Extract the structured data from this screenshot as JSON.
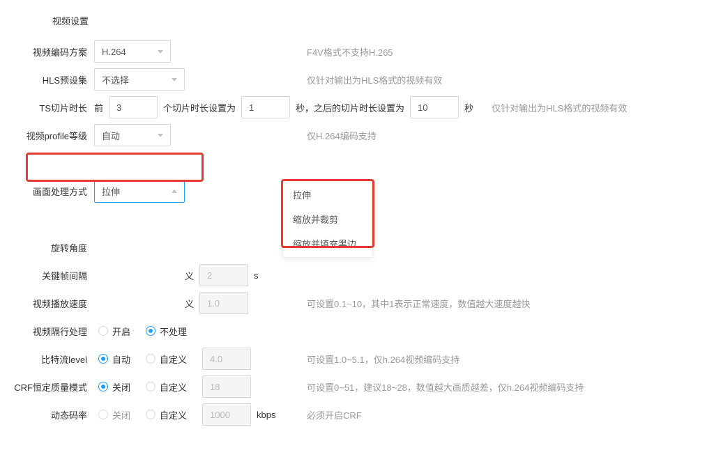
{
  "section_title": "视频设置",
  "rows": {
    "codec": {
      "label": "视频编码方案",
      "value": "H.264",
      "hint": "F4V格式不支持H.265"
    },
    "hls": {
      "label": "HLS预设集",
      "value": "不选择",
      "hint": "仅针对输出为HLS格式的视频有效"
    },
    "ts": {
      "label": "TS切片时长",
      "t1": "前",
      "v1": "3",
      "t2": "个切片时长设置为",
      "v2": "1",
      "t3": "秒，之后的切片时长设置为",
      "v3": "10",
      "t4": "秒",
      "hint": "仅针对输出为HLS格式的视频有效"
    },
    "profile": {
      "label": "视频profile等级",
      "value": "自动",
      "hint": "仅H.264编码支持"
    },
    "screen": {
      "label": "画面处理方式",
      "value": "拉伸",
      "options": [
        "拉伸",
        "缩放并裁剪",
        "缩放并填充黑边"
      ]
    },
    "rotate": {
      "label": "旋转角度"
    },
    "keyframe": {
      "label": "关键帧间隔",
      "custom_label": "义",
      "val": "2",
      "unit": "s"
    },
    "speed": {
      "label": "视频播放速度",
      "custom_label": "义",
      "val": "1.0",
      "hint": "可设置0.1~10，其中1表示正常速度，数值越大速度越快"
    },
    "interlace": {
      "label": "视频隔行处理",
      "r1": "开启",
      "r2": "不处理"
    },
    "level": {
      "label": "比特流level",
      "r1": "自动",
      "r2": "自定义",
      "val": "4.0",
      "hint": "可设置1.0~5.1，仅h.264视频编码支持"
    },
    "crf": {
      "label": "CRF恒定质量模式",
      "r1": "关闭",
      "r2": "自定义",
      "val": "18",
      "hint": "可设置0~51，建议18~28，数值越大画质越差，仅h.264视频编码支持"
    },
    "vbr": {
      "label": "动态码率",
      "r1": "关闭",
      "r2": "自定义",
      "val": "1000",
      "unit": "kbps",
      "hint": "必须开启CRF"
    }
  }
}
